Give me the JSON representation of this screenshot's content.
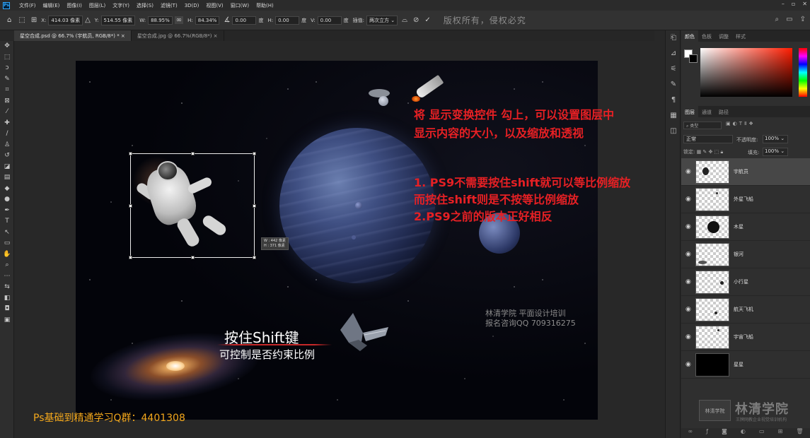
{
  "menubar": {
    "logo": "Ps",
    "items": [
      "文件(F)",
      "编辑(E)",
      "图像(I)",
      "图层(L)",
      "文字(Y)",
      "选择(S)",
      "滤镜(T)",
      "3D(D)",
      "视图(V)",
      "窗口(W)",
      "帮助(H)"
    ],
    "window_controls": [
      "–",
      "▫",
      "✕"
    ]
  },
  "options": {
    "x_label": "X:",
    "x_value": "414.03 像素",
    "y_label": "Y:",
    "y_value": "514.55 像素",
    "w_label": "W:",
    "w_value": "88.95%",
    "h_label": "H:",
    "h_value": "84.34%",
    "angle_value": "0.00",
    "angle_unit": "度",
    "hskew_label": "H:",
    "hskew_value": "0.00",
    "hskew_unit": "度",
    "vskew_label": "V:",
    "vskew_value": "0.00",
    "vskew_unit": "度",
    "interp_label": "插值:",
    "interp_value": "两次立方 ⌄",
    "copyright": "版权所有，侵权必究"
  },
  "tabs": [
    {
      "label": "星空合成.psd @ 66.7% (宇航员, RGB/8*) *  ×"
    },
    {
      "label": "星空合成.jpg @ 66.7%(RGB/8*)  ×"
    }
  ],
  "canvas": {
    "annotation1": [
      "将 显示变换控件 勾上，可以设置图层中",
      "显示内容的大小，以及缩放和透视"
    ],
    "annotation2": [
      "1. PS9不需要按住shift就可以等比例缩放",
      "而按住shift则是不按等比例缩放",
      "2.PS9之前的版本正好相反"
    ],
    "shift_title": "按住Shift键",
    "shift_sub": "可控制是否约束比例",
    "watermark": [
      "林清学院  平面设计培训",
      "报名咨询QQ 709316275"
    ],
    "size_readout": [
      "W : 442 像素",
      "H : 371 像素"
    ],
    "qq_group": "Ps基础到精通学习Q群：4401308"
  },
  "panel": {
    "color_tabs": [
      "颜色",
      "色板",
      "调整",
      "样式"
    ],
    "layer_tabs": [
      "图层",
      "通道",
      "路径"
    ],
    "filter_label": "⌕ 类型",
    "blend_mode": "正常",
    "opacity_label": "不透明度:",
    "opacity_value": "100% ⌄",
    "lock_label": "锁定:",
    "fill_label": "填充:",
    "fill_value": "100% ⌄",
    "layers": [
      {
        "name": "宇航员",
        "selected": true
      },
      {
        "name": "外星飞船",
        "selected": false
      },
      {
        "name": "木星",
        "selected": false
      },
      {
        "name": "银河",
        "selected": false
      },
      {
        "name": "小行星",
        "selected": false
      },
      {
        "name": "航天飞机",
        "selected": false
      },
      {
        "name": "宇宙飞船",
        "selected": false
      },
      {
        "name": "星星",
        "selected": false
      }
    ],
    "logo_text": "林清学院",
    "logo_sub": "王牌网教企业视觉培训机构"
  }
}
